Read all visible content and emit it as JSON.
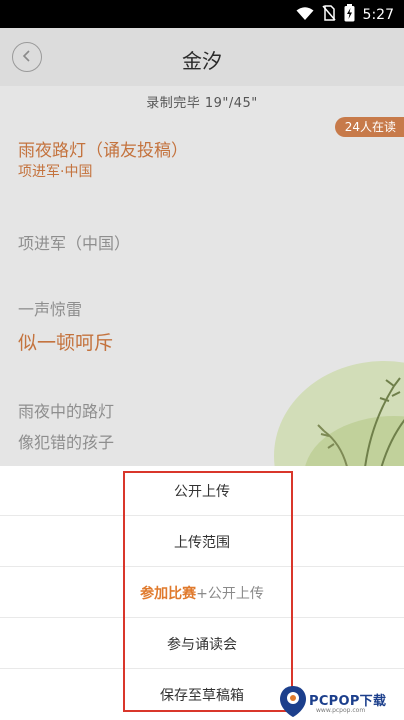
{
  "status_bar": {
    "time": "5:27",
    "icons": [
      "wifi-icon",
      "no-sim-icon",
      "battery-charging-icon"
    ]
  },
  "nav": {
    "title": "金汐",
    "back_icon": "chevron-left-icon"
  },
  "recording": {
    "status": "录制完毕 19\"/45\""
  },
  "badge": {
    "readers": "24人在读"
  },
  "poem": {
    "title": "雨夜路灯（诵友投稿）",
    "author": "项进军·中国",
    "lines": [
      {
        "text": "项进军（中国）",
        "highlight": false
      },
      {
        "text": "一声惊雷",
        "highlight": false
      },
      {
        "text": "似一顿呵斥",
        "highlight": true
      },
      {
        "text": "雨夜中的路灯",
        "highlight": false
      },
      {
        "text": "像犯错的孩子",
        "highlight": false
      }
    ]
  },
  "sheet": {
    "items": [
      {
        "label": "公开上传"
      },
      {
        "label": "上传范围"
      },
      {
        "accent": "参加比赛",
        "rest": "+公开上传"
      },
      {
        "label": "参与诵读会"
      },
      {
        "label": "保存至草稿箱"
      }
    ]
  },
  "watermark": {
    "brand": "PCPOP下载",
    "sub": "www.pcpop.com"
  },
  "colors": {
    "accent": "#e07a2d",
    "poem_accent": "#c4733e",
    "highlight_box": "#d9362b",
    "badge": "#c77a4a"
  }
}
